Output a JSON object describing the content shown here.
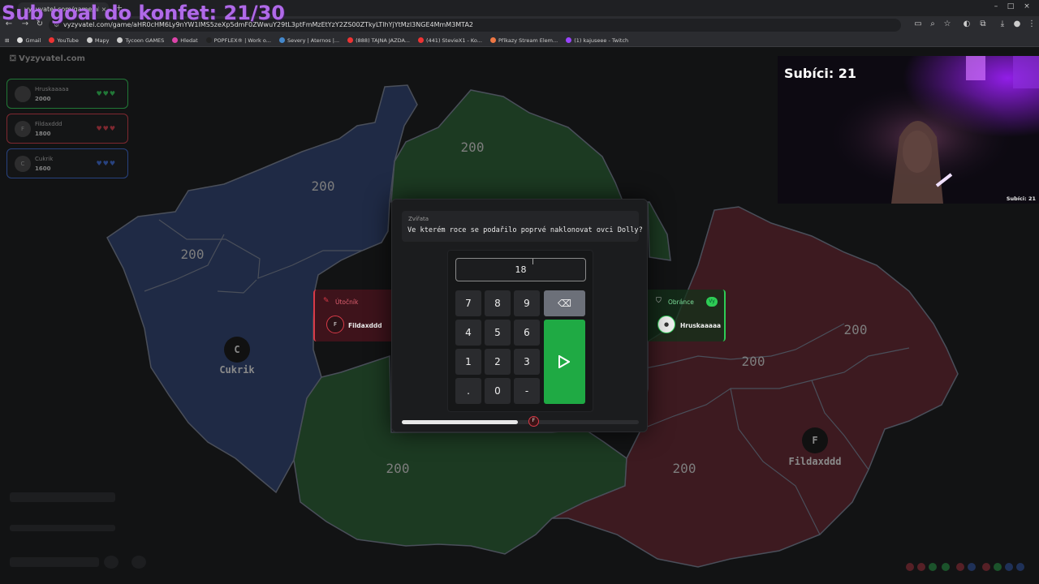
{
  "overlay": {
    "sub_goal": "Sub goal do konfet: 21/30"
  },
  "browser": {
    "tab_title": "vyzyvatel.com/game/aHR",
    "url": "vyzyvatel.com/game/aHR0cHM6Ly9nYW1lMS5zeXp5dmF0ZWwuY29tL3ptFmMzEtYzY2ZS00ZTkyLTlhYjYtMzI3NGE4MmM3MTA2",
    "bookmarks": [
      "Gmail",
      "YouTube",
      "Mapy",
      "Tycoon GAMES",
      "Hledat",
      "POPFLEX® | Work o...",
      "Severy | Aternos |...",
      "(888) TAJNA JAZDA...",
      "(441) StevieX1 - Ko...",
      "Příkazy Stream Elem...",
      "(1) kajuseee - Twitch"
    ]
  },
  "app": {
    "logo": "Vyzyvatel.com"
  },
  "players": [
    {
      "name": "Hruskaaaaa",
      "score": "2000",
      "avatar": "",
      "color": "#2ecc55",
      "hearts": "♥♥♥"
    },
    {
      "name": "Fildaxddd",
      "score": "1800",
      "avatar": "F",
      "color": "#d83a48",
      "hearts": "♥♥♥"
    },
    {
      "name": "Cukrik",
      "score": "1600",
      "avatar": "C",
      "color": "#3a6ad8",
      "hearts": "♥♥♥"
    }
  ],
  "map": {
    "region_value": "200",
    "players": [
      {
        "name": "Cukrik",
        "initial": "C"
      },
      {
        "name": "Fildaxddd",
        "initial": "F"
      }
    ]
  },
  "question": {
    "category": "Zvířata",
    "text": "Ve kterém roce se podařilo poprvé naklonovat ovci Dolly?",
    "answer": "18",
    "keys": [
      "7",
      "8",
      "9",
      "4",
      "5",
      "6",
      "1",
      "2",
      "3",
      ".",
      "0",
      "-"
    ],
    "timer_progress": 0.49,
    "timer_player": "F"
  },
  "attacker": {
    "title": "Útočník",
    "name": "Fildaxddd",
    "initial": "F"
  },
  "defender": {
    "title": "Obránce",
    "name": "Hruskaaaaa",
    "badge": "Vy"
  },
  "webcam": {
    "title": "Subíci: 21",
    "small": "Subíci: 21"
  },
  "colors": {
    "blue": "#1f2a45",
    "green": "#1c3a22",
    "red": "#3d1a20",
    "accent": "#1faa44"
  }
}
